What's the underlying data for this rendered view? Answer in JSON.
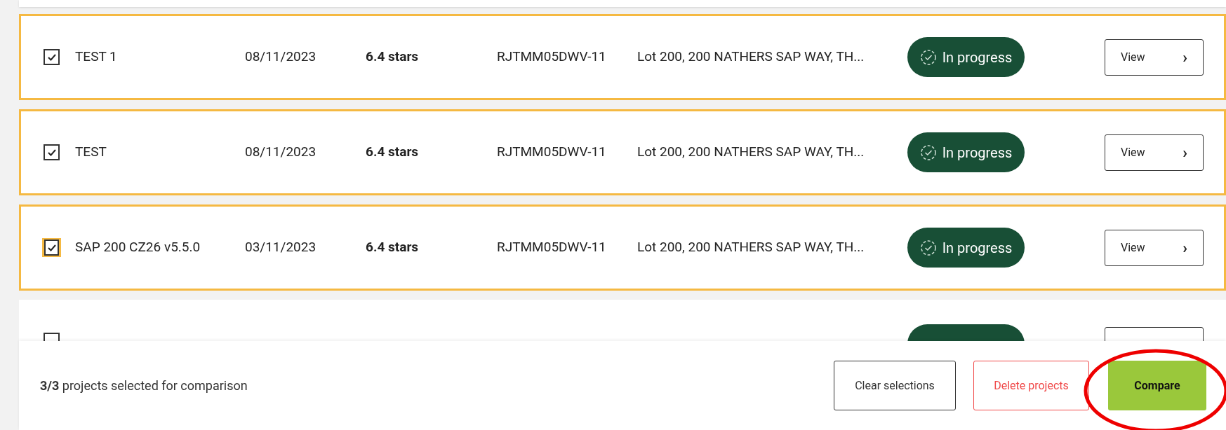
{
  "rows": [
    {
      "checked": true,
      "focused": false,
      "name": "TEST 1",
      "date": "08/11/2023",
      "rating": "6.4 stars",
      "code": "RJTMM05DWV-11",
      "address": "Lot 200, 200 NATHERS SAP WAY, TH...",
      "status": "In progress",
      "action": "View",
      "chevron": "›"
    },
    {
      "checked": true,
      "focused": false,
      "name": "TEST",
      "date": "08/11/2023",
      "rating": "6.4 stars",
      "code": "RJTMM05DWV-11",
      "address": "Lot 200, 200 NATHERS SAP WAY, TH...",
      "status": "In progress",
      "action": "View",
      "chevron": "›"
    },
    {
      "checked": true,
      "focused": true,
      "name": "SAP 200 CZ26 v5.5.0",
      "date": "03/11/2023",
      "rating": "6.4 stars",
      "code": "RJTMM05DWV-11",
      "address": "Lot 200, 200 NATHERS SAP WAY, TH...",
      "status": "In progress",
      "action": "View",
      "chevron": "›"
    }
  ],
  "partial_row": {
    "checked": false
  },
  "footer": {
    "summary": "**3/3** projects selected for comparison",
    "clear_button": "Clear selections",
    "delete_button": "Delete projects",
    "compare_button": "Compare",
    "compare_circled": true
  }
}
